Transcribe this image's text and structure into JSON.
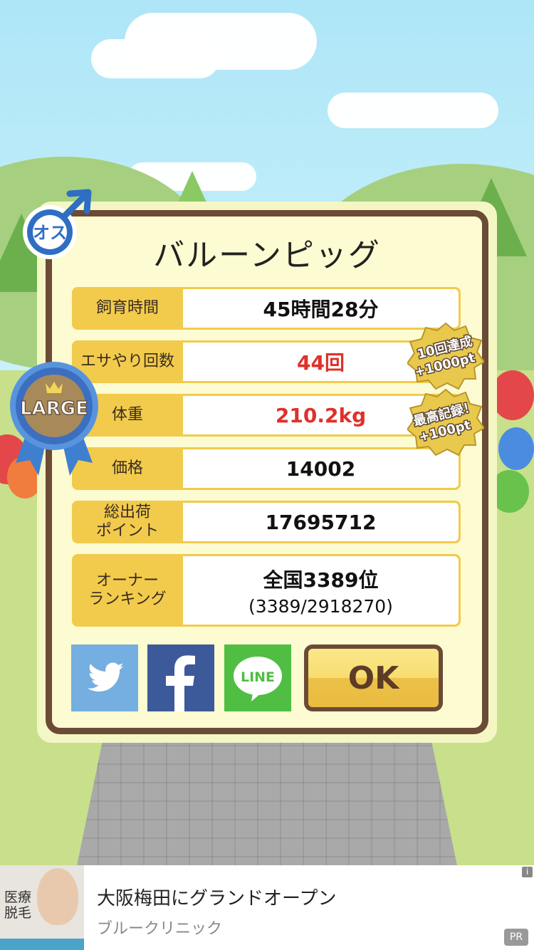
{
  "title": "バルーンピッグ",
  "gender_label": "オス",
  "size_badge": "LARGE",
  "rows": [
    {
      "label": "飼育時間",
      "value": "45時間28分"
    },
    {
      "label": "エサやり回数",
      "value": "44回"
    },
    {
      "label": "体重",
      "value": "210.2kg"
    },
    {
      "label": "価格",
      "value": "14002"
    },
    {
      "label": "総出荷\nポイント",
      "value": "17695712"
    },
    {
      "label": "オーナー\nランキング",
      "value": "全国3389位",
      "sub": "(3389/2918270)"
    }
  ],
  "achievements": [
    {
      "line1": "10回達成",
      "line2": "+1000pt"
    },
    {
      "line1": "最高記録！",
      "line2": "+100pt"
    }
  ],
  "buttons": {
    "twitter": "twitter-share",
    "facebook": "facebook-share",
    "line": "LINE",
    "ok": "OK"
  },
  "ad": {
    "image_text": "医療\n脱毛",
    "title": "大阪梅田にグランドオープン",
    "advertiser": "ブルークリニック",
    "pr": "PR",
    "info": "i"
  },
  "colors": {
    "panel_border": "#6b4a36",
    "label_bg": "#f2cb4c",
    "red_value": "#e0302a",
    "twitter": "#75aee0",
    "facebook": "#3c5a99",
    "line": "#4fbe43"
  }
}
